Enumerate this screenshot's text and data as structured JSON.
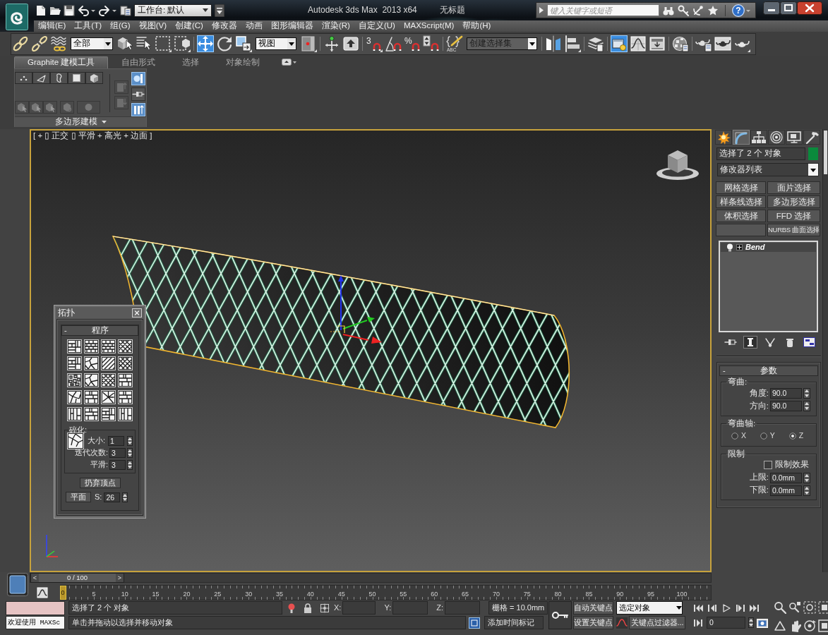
{
  "title_bar": {
    "workspace": "工作台: 默认",
    "app_title": "Autodesk 3ds Max  2013 x64",
    "document_title": "无标题",
    "search": {
      "placeholder": "键入关键字或短语"
    },
    "help_button": "?"
  },
  "menu": [
    "编辑(E)",
    "工具(T)",
    "组(G)",
    "视图(V)",
    "创建(C)",
    "修改器",
    "动画",
    "图形编辑器",
    "渲染(R)",
    "自定义(U)",
    "MAXScript(M)",
    "帮助(H)"
  ],
  "main_toolbar": {
    "groups": [
      [
        {
          "kind": "tool",
          "selected": false
        },
        {
          "kind": "tool",
          "selected": false
        },
        {
          "kind": "tool",
          "selected": false
        },
        {
          "kind": "dropdown",
          "value": "全部",
          "disabled": false
        },
        {
          "kind": "tool",
          "selected": false
        },
        {
          "kind": "tool",
          "selected": false
        },
        {
          "kind": "tool",
          "selected": false
        },
        {
          "kind": "tool",
          "selected": false
        }
      ],
      [
        {
          "kind": "tool",
          "selected": true
        },
        {
          "kind": "tool",
          "selected": false
        },
        {
          "kind": "tool",
          "selected": false
        },
        {
          "kind": "dropdown",
          "value": "视图",
          "disabled": false
        },
        {
          "kind": "tool",
          "selected": false
        }
      ],
      [
        {
          "kind": "tool",
          "selected": false
        },
        {
          "kind": "tool",
          "selected": false
        }
      ],
      [
        {
          "kind": "tool",
          "selected": false,
          "glyph": "3"
        },
        {
          "kind": "tool",
          "selected": false
        },
        {
          "kind": "tool",
          "selected": false,
          "glyph": "%"
        },
        {
          "kind": "tool",
          "selected": false
        }
      ],
      [
        {
          "kind": "tool",
          "selected": false,
          "glyph": "ABC"
        },
        {
          "kind": "dropdown",
          "value": "创建选择集",
          "disabled": true
        }
      ],
      [
        {
          "kind": "tool",
          "selected": false
        },
        {
          "kind": "tool",
          "selected": false
        }
      ],
      [
        {
          "kind": "tool",
          "selected": false
        }
      ],
      [
        {
          "kind": "tool",
          "selected": true
        },
        {
          "kind": "tool",
          "selected": false
        },
        {
          "kind": "tool",
          "selected": false
        }
      ],
      [
        {
          "kind": "tool",
          "selected": false
        }
      ],
      [
        {
          "kind": "tool",
          "selected": false
        },
        {
          "kind": "tool",
          "selected": false
        },
        {
          "kind": "tool",
          "selected": false
        }
      ]
    ]
  },
  "ribbon": {
    "tabs": [
      {
        "label": "Graphite 建模工具",
        "selected": true
      },
      {
        "label": "自由形式",
        "selected": false
      },
      {
        "label": "选择",
        "selected": false
      },
      {
        "label": "对象绘制",
        "selected": false
      }
    ],
    "panel": {
      "title": "多边形建模",
      "subobjects": [
        {
          "selected": false
        },
        {
          "selected": false
        },
        {
          "selected": false
        },
        {
          "selected": false
        },
        {
          "selected": false
        }
      ],
      "modify_tools": [
        {
          "disabled": true
        },
        {
          "disabled": true
        },
        {
          "disabled": true
        },
        {
          "disabled": true
        },
        {
          "disabled": true
        }
      ],
      "navigation": [
        {
          "disabled": true
        },
        {
          "disabled": true
        }
      ],
      "toggles": [
        {
          "selected": true
        },
        {
          "selected": false
        },
        {
          "selected": true
        }
      ]
    }
  },
  "viewport": {
    "label": "[ + ▯ 正交 ▯ 平滑 + 高光 + 边面 ]",
    "active": true
  },
  "topology_dialog": {
    "title": "拓扑",
    "rollout": {
      "toggle": "-",
      "title": "程序"
    },
    "fracture": {
      "title": "碎化:",
      "fields": [
        {
          "label": "大小:",
          "value": "1"
        },
        {
          "label": "迭代次数:",
          "value": "3"
        },
        {
          "label": "平滑:",
          "value": "3"
        }
      ]
    },
    "discard_button": "扔弃顶点",
    "plane_button": "平面",
    "s_field": {
      "label": "S:",
      "value": "26"
    }
  },
  "command_panel": {
    "tabs": [
      {
        "selected": false
      },
      {
        "selected": true
      },
      {
        "selected": false
      },
      {
        "selected": false
      },
      {
        "selected": false
      },
      {
        "selected": false
      }
    ],
    "object_name": "选择了 2 个 对象",
    "modifier_list": "修改器列表",
    "modifier_buttons": [
      {
        "kind": "button",
        "label": "网格选择"
      },
      {
        "kind": "button",
        "label": "面片选择"
      },
      {
        "kind": "button",
        "label": "样条线选择"
      },
      {
        "kind": "button",
        "label": "多边形选择"
      },
      {
        "kind": "button",
        "label": "体积选择"
      },
      {
        "kind": "button",
        "label": "FFD 选择"
      },
      {
        "kind": "blank"
      },
      {
        "kind": "button",
        "label": "NURBS 曲面选择"
      }
    ],
    "stack": [
      {
        "name": "Bend",
        "enabled": true,
        "expanded": false
      }
    ],
    "stack_tools": [
      {
        "selected": false
      },
      {
        "selected": true
      },
      {
        "selected": false
      },
      {
        "selected": false
      },
      {
        "selected": false
      }
    ],
    "parameters": {
      "toggle": "-",
      "title": "参数",
      "bend": {
        "title": "弯曲:",
        "fields": [
          {
            "label": "角度:",
            "value": "90.0"
          },
          {
            "label": "方向:",
            "value": "90.0"
          }
        ]
      },
      "bend_axis": {
        "title": "弯曲轴:",
        "options": [
          {
            "label": "X",
            "selected": false
          },
          {
            "label": "Y",
            "selected": false
          },
          {
            "label": "Z",
            "selected": true
          }
        ]
      },
      "limits": {
        "title": "限制",
        "limit_effect": {
          "label": "限制效果",
          "checked": false
        },
        "fields": [
          {
            "label": "上限:",
            "value": "0.0mm"
          },
          {
            "label": "下限:",
            "value": "0.0mm"
          }
        ]
      }
    }
  },
  "time_slider": {
    "label": "0 / 100",
    "level": 0,
    "previous": "<",
    "next": ">"
  },
  "track_bar": {
    "current_frame": "0",
    "ticks": [
      "5",
      "10",
      "15",
      "20",
      "25",
      "30",
      "35",
      "40",
      "45",
      "50",
      "55",
      "60",
      "65",
      "70",
      "75",
      "80",
      "85",
      "90",
      "95",
      "100"
    ]
  },
  "status_bar": {
    "listener_output": "欢迎使用 MAXSc",
    "prompt": "选择了 2 个 对象",
    "hint": "单击并拖动以选择并移动对象",
    "coordinates": [
      {
        "label": "X:"
      },
      {
        "label": "Y:"
      },
      {
        "label": "Z:"
      }
    ],
    "grid": "栅格 = 10.0mm",
    "time_tag": "添加时间标记",
    "auto_key": "自动关键点",
    "set_key": "设置关键点",
    "key_target": "选定对象",
    "key_filters": "关键点过滤器...",
    "frame": "0"
  }
}
